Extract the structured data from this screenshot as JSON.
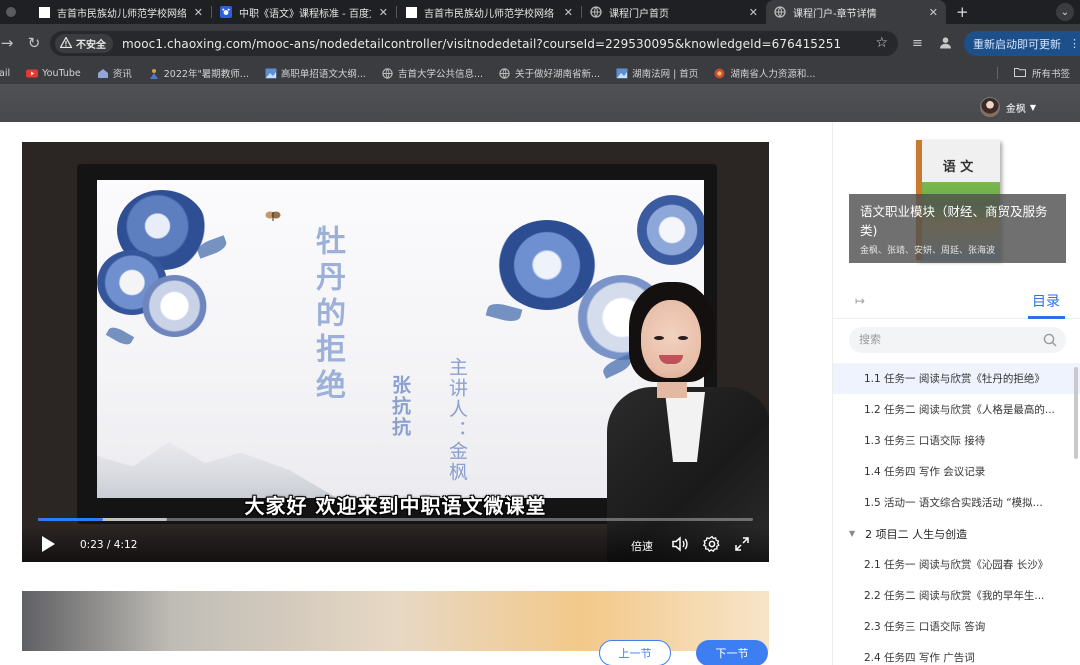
{
  "browser": {
    "tabs": [
      {
        "title": "吉首市民族幼儿师范学校网络",
        "active": false
      },
      {
        "title": "中职《语文》课程标准 - 百度文",
        "active": false
      },
      {
        "title": "吉首市民族幼儿师范学校网络",
        "active": false
      },
      {
        "title": "课程门户首页",
        "active": false
      },
      {
        "title": "课程门户-章节详情",
        "active": true
      }
    ],
    "security_label": "不安全",
    "url": "mooc1.chaoxing.com/mooc-ans/nodedetailcontroller/visitnodedetail?courseId=229530095&knowledgeId=676415251",
    "relaunch_label": "重新启动即可更新",
    "bookmarks": [
      {
        "label": "ail",
        "icon": "none"
      },
      {
        "label": "YouTube",
        "icon": "youtube-icon"
      },
      {
        "label": "资讯",
        "icon": "news-icon"
      },
      {
        "label": "2022年\"暑期教师...",
        "icon": "figure-icon"
      },
      {
        "label": "高职单招语文大纲...",
        "icon": "image-icon"
      },
      {
        "label": "吉首大学公共信息...",
        "icon": "globe-icon"
      },
      {
        "label": "关于做好湖南省新...",
        "icon": "globe-icon"
      },
      {
        "label": "湖南法网 | 首页",
        "icon": "image-icon"
      },
      {
        "label": "湖南省人力资源和...",
        "icon": "emblem-icon"
      }
    ],
    "all_bookmarks_label": "所有书签"
  },
  "header": {
    "user_name": "金枫"
  },
  "video": {
    "title_vertical": "牡丹的拒绝",
    "author_vertical": "张抗抗",
    "lecturer_vertical": "主讲人：金枫",
    "subtitle": "大家好  欢迎来到中职语文微课堂",
    "current_time": "0:23",
    "duration": "4:12",
    "time_display": "0:23 / 4:12",
    "speed_label": "倍速",
    "played_fraction": 0.091,
    "buffered_fraction": 0.18
  },
  "pager": {
    "prev_label": "上一节",
    "next_label": "下一节"
  },
  "sidebar": {
    "book_title": "语 文",
    "course_name": "语文职业模块（财经、商贸及服务类)",
    "teachers": "金枫、张靖、安妍、周延、张海波",
    "toc_tab_label": "目录",
    "search_placeholder": "搜索",
    "toc": [
      {
        "label": "1.1 任务一  阅读与欣赏《牡丹的拒绝》",
        "type": "section",
        "active": true
      },
      {
        "label": "1.2 任务二  阅读与欣赏《人格是最高的...",
        "type": "section",
        "active": false
      },
      {
        "label": "1.3 任务三  口语交际  接待",
        "type": "section",
        "active": false
      },
      {
        "label": "1.4 任务四  写作  会议记录",
        "type": "section",
        "active": false
      },
      {
        "label": "1.5 活动一  语文综合实践活动 “模拟...",
        "type": "section",
        "active": false
      },
      {
        "label": "2  项目二  人生与创造",
        "type": "chapter",
        "active": false
      },
      {
        "label": "2.1 任务一  阅读与欣赏《沁园春  长沙》",
        "type": "section",
        "active": false
      },
      {
        "label": "2.2 任务二  阅读与欣赏《我的早年生...",
        "type": "section",
        "active": false
      },
      {
        "label": "2.3 任务三  口语交际  答询",
        "type": "section",
        "active": false
      },
      {
        "label": "2.4 任务四  写作  广告词",
        "type": "section",
        "active": false
      }
    ]
  },
  "colors": {
    "accent": "#3d7ff3",
    "toc_active_bg": "#eef3fd",
    "chrome_dark": "#3b3c40",
    "relaunch_bg": "#1d4f8a"
  }
}
